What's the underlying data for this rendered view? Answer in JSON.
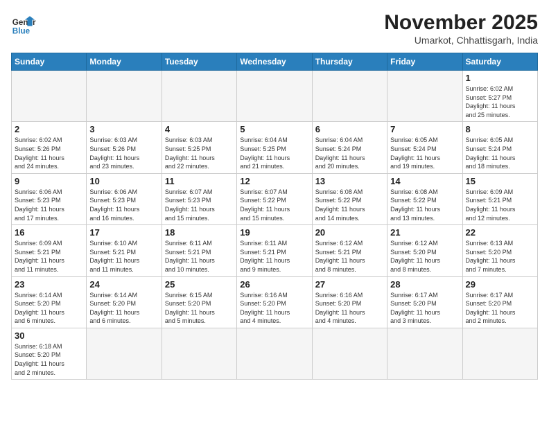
{
  "header": {
    "logo_general": "General",
    "logo_blue": "Blue",
    "month_year": "November 2025",
    "location": "Umarkot, Chhattisgarh, India"
  },
  "weekdays": [
    "Sunday",
    "Monday",
    "Tuesday",
    "Wednesday",
    "Thursday",
    "Friday",
    "Saturday"
  ],
  "weeks": [
    [
      {
        "day": "",
        "info": ""
      },
      {
        "day": "",
        "info": ""
      },
      {
        "day": "",
        "info": ""
      },
      {
        "day": "",
        "info": ""
      },
      {
        "day": "",
        "info": ""
      },
      {
        "day": "",
        "info": ""
      },
      {
        "day": "1",
        "info": "Sunrise: 6:02 AM\nSunset: 5:27 PM\nDaylight: 11 hours\nand 25 minutes."
      }
    ],
    [
      {
        "day": "2",
        "info": "Sunrise: 6:02 AM\nSunset: 5:26 PM\nDaylight: 11 hours\nand 24 minutes."
      },
      {
        "day": "3",
        "info": "Sunrise: 6:03 AM\nSunset: 5:26 PM\nDaylight: 11 hours\nand 23 minutes."
      },
      {
        "day": "4",
        "info": "Sunrise: 6:03 AM\nSunset: 5:25 PM\nDaylight: 11 hours\nand 22 minutes."
      },
      {
        "day": "5",
        "info": "Sunrise: 6:04 AM\nSunset: 5:25 PM\nDaylight: 11 hours\nand 21 minutes."
      },
      {
        "day": "6",
        "info": "Sunrise: 6:04 AM\nSunset: 5:24 PM\nDaylight: 11 hours\nand 20 minutes."
      },
      {
        "day": "7",
        "info": "Sunrise: 6:05 AM\nSunset: 5:24 PM\nDaylight: 11 hours\nand 19 minutes."
      },
      {
        "day": "8",
        "info": "Sunrise: 6:05 AM\nSunset: 5:24 PM\nDaylight: 11 hours\nand 18 minutes."
      }
    ],
    [
      {
        "day": "9",
        "info": "Sunrise: 6:06 AM\nSunset: 5:23 PM\nDaylight: 11 hours\nand 17 minutes."
      },
      {
        "day": "10",
        "info": "Sunrise: 6:06 AM\nSunset: 5:23 PM\nDaylight: 11 hours\nand 16 minutes."
      },
      {
        "day": "11",
        "info": "Sunrise: 6:07 AM\nSunset: 5:23 PM\nDaylight: 11 hours\nand 15 minutes."
      },
      {
        "day": "12",
        "info": "Sunrise: 6:07 AM\nSunset: 5:22 PM\nDaylight: 11 hours\nand 15 minutes."
      },
      {
        "day": "13",
        "info": "Sunrise: 6:08 AM\nSunset: 5:22 PM\nDaylight: 11 hours\nand 14 minutes."
      },
      {
        "day": "14",
        "info": "Sunrise: 6:08 AM\nSunset: 5:22 PM\nDaylight: 11 hours\nand 13 minutes."
      },
      {
        "day": "15",
        "info": "Sunrise: 6:09 AM\nSunset: 5:21 PM\nDaylight: 11 hours\nand 12 minutes."
      }
    ],
    [
      {
        "day": "16",
        "info": "Sunrise: 6:09 AM\nSunset: 5:21 PM\nDaylight: 11 hours\nand 11 minutes."
      },
      {
        "day": "17",
        "info": "Sunrise: 6:10 AM\nSunset: 5:21 PM\nDaylight: 11 hours\nand 11 minutes."
      },
      {
        "day": "18",
        "info": "Sunrise: 6:11 AM\nSunset: 5:21 PM\nDaylight: 11 hours\nand 10 minutes."
      },
      {
        "day": "19",
        "info": "Sunrise: 6:11 AM\nSunset: 5:21 PM\nDaylight: 11 hours\nand 9 minutes."
      },
      {
        "day": "20",
        "info": "Sunrise: 6:12 AM\nSunset: 5:21 PM\nDaylight: 11 hours\nand 8 minutes."
      },
      {
        "day": "21",
        "info": "Sunrise: 6:12 AM\nSunset: 5:20 PM\nDaylight: 11 hours\nand 8 minutes."
      },
      {
        "day": "22",
        "info": "Sunrise: 6:13 AM\nSunset: 5:20 PM\nDaylight: 11 hours\nand 7 minutes."
      }
    ],
    [
      {
        "day": "23",
        "info": "Sunrise: 6:14 AM\nSunset: 5:20 PM\nDaylight: 11 hours\nand 6 minutes."
      },
      {
        "day": "24",
        "info": "Sunrise: 6:14 AM\nSunset: 5:20 PM\nDaylight: 11 hours\nand 6 minutes."
      },
      {
        "day": "25",
        "info": "Sunrise: 6:15 AM\nSunset: 5:20 PM\nDaylight: 11 hours\nand 5 minutes."
      },
      {
        "day": "26",
        "info": "Sunrise: 6:16 AM\nSunset: 5:20 PM\nDaylight: 11 hours\nand 4 minutes."
      },
      {
        "day": "27",
        "info": "Sunrise: 6:16 AM\nSunset: 5:20 PM\nDaylight: 11 hours\nand 4 minutes."
      },
      {
        "day": "28",
        "info": "Sunrise: 6:17 AM\nSunset: 5:20 PM\nDaylight: 11 hours\nand 3 minutes."
      },
      {
        "day": "29",
        "info": "Sunrise: 6:17 AM\nSunset: 5:20 PM\nDaylight: 11 hours\nand 2 minutes."
      }
    ],
    [
      {
        "day": "30",
        "info": "Sunrise: 6:18 AM\nSunset: 5:20 PM\nDaylight: 11 hours\nand 2 minutes."
      },
      {
        "day": "",
        "info": ""
      },
      {
        "day": "",
        "info": ""
      },
      {
        "day": "",
        "info": ""
      },
      {
        "day": "",
        "info": ""
      },
      {
        "day": "",
        "info": ""
      },
      {
        "day": "",
        "info": ""
      }
    ]
  ]
}
